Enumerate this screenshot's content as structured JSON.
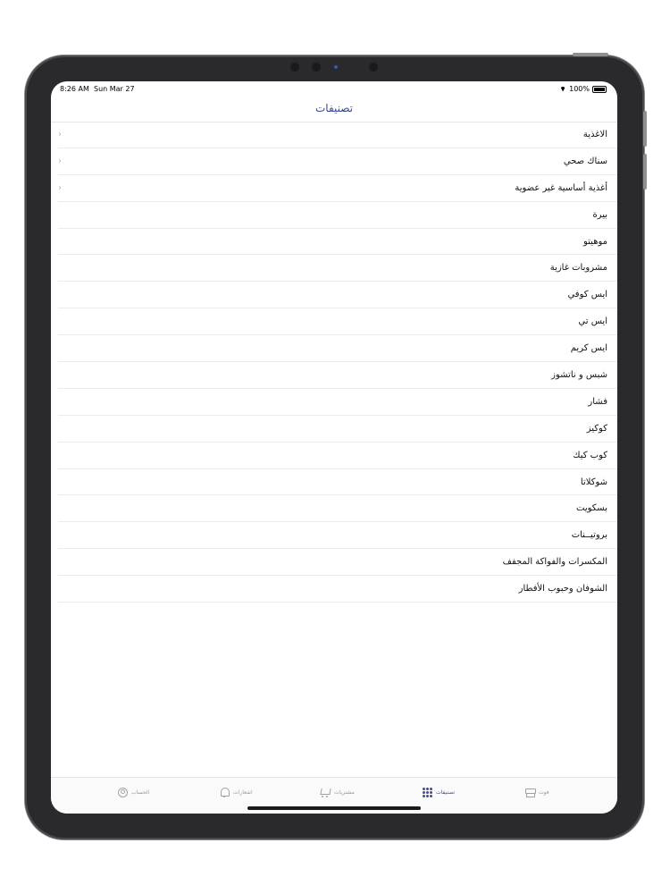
{
  "status_bar": {
    "time": "8:26 AM",
    "date": "Sun Mar 27",
    "battery": "100%"
  },
  "header": {
    "title": "تصنيفات"
  },
  "categories": [
    {
      "label": "الاغذية",
      "has_chevron": true
    },
    {
      "label": "سناك صحي",
      "has_chevron": true
    },
    {
      "label": "أغذية أساسية  غير عضوية",
      "has_chevron": true
    },
    {
      "label": "بيرة",
      "has_chevron": false
    },
    {
      "label": "موهيتو",
      "has_chevron": false
    },
    {
      "label": "مشروبات غازية",
      "has_chevron": false
    },
    {
      "label": "ايس كوفي",
      "has_chevron": false
    },
    {
      "label": "ايس تي",
      "has_chevron": false
    },
    {
      "label": "ايس كريم",
      "has_chevron": false
    },
    {
      "label": "شبس و ناتشوز",
      "has_chevron": false
    },
    {
      "label": "فشار",
      "has_chevron": false
    },
    {
      "label": "كوكيز",
      "has_chevron": false
    },
    {
      "label": "كوب كيك",
      "has_chevron": false
    },
    {
      "label": "شوكلاتا",
      "has_chevron": false
    },
    {
      "label": "بسكويت",
      "has_chevron": false
    },
    {
      "label": "بروتيــنات",
      "has_chevron": false
    },
    {
      "label": "المكسرات والفواكة المجفف",
      "has_chevron": false
    },
    {
      "label": "الشوفان وحبوب الأفطار",
      "has_chevron": false
    }
  ],
  "tabbar": {
    "account_label": "الحساب",
    "notifications_label": "اشعارات",
    "purchases_label": "مشتريات",
    "categories_label": "تصنيفات",
    "store_label": "فوت",
    "active_tab": "categories"
  },
  "colors": {
    "accent": "#3d4e9a",
    "inactive": "#9a9aa0",
    "separator": "#ececf0"
  }
}
